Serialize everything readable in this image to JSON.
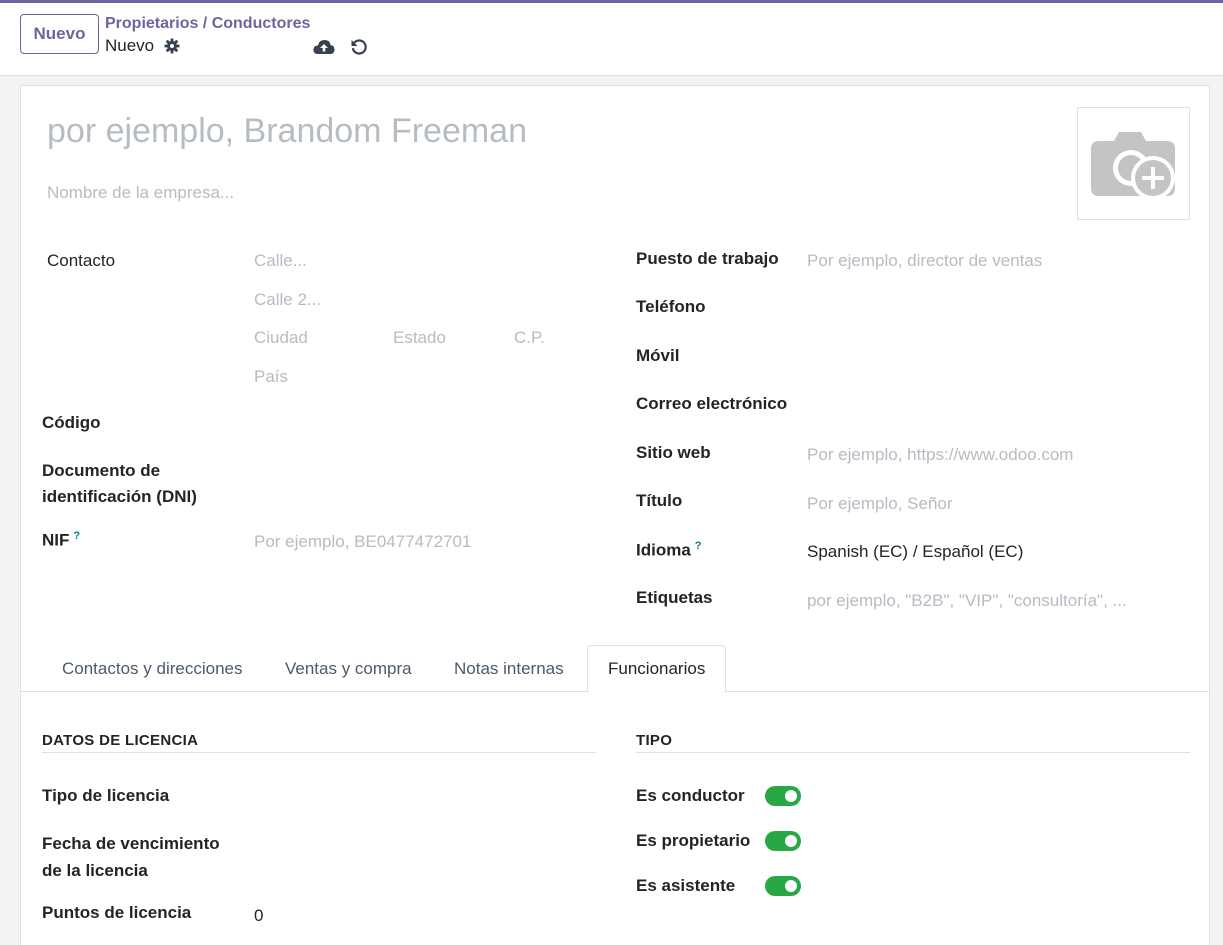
{
  "header": {
    "new_button": "Nuevo",
    "breadcrumb_parent": "Propietarios / Conductores",
    "breadcrumb_current": "Nuevo",
    "icons": [
      "gear-icon",
      "cloud-upload-icon",
      "undo-icon"
    ]
  },
  "form": {
    "name_placeholder": "por ejemplo, Brandom Freeman",
    "company_placeholder": "Nombre de la empresa...",
    "avatar_icon": "camera-plus-icon",
    "left": {
      "contact_label": "Contacto",
      "street_ph": "Calle...",
      "street2_ph": "Calle 2...",
      "city_ph": "Ciudad",
      "state_ph": "Estado",
      "zip_ph": "C.P.",
      "country_ph": "País",
      "code_label": "Código",
      "dni_label_1": "Documento de",
      "dni_label_2": "identificación (DNI)",
      "nif_label": "NIF",
      "nif_help": "?",
      "nif_ph": "Por ejemplo, BE0477472701"
    },
    "right": {
      "job_label": "Puesto de trabajo",
      "job_ph": "Por ejemplo, director de ventas",
      "phone_label": "Teléfono",
      "mobile_label": "Móvil",
      "email_label": "Correo electrónico",
      "website_label": "Sitio web",
      "website_ph": "Por ejemplo, https://www.odoo.com",
      "title_label": "Título",
      "title_ph": "Por ejemplo, Señor",
      "lang_label": "Idioma",
      "lang_help": "?",
      "lang_value": "Spanish (EC) / Español (EC)",
      "tags_label": "Etiquetas",
      "tags_ph": "por ejemplo, \"B2B\", \"VIP\", \"consultoría\", ..."
    }
  },
  "tabs": [
    {
      "label": "Contactos y direcciones",
      "active": false
    },
    {
      "label": "Ventas y compra",
      "active": false
    },
    {
      "label": "Notas internas",
      "active": false
    },
    {
      "label": "Funcionarios",
      "active": true
    }
  ],
  "license": {
    "section_title": "DATOS DE LICENCIA",
    "type_label": "Tipo de licencia",
    "expiry_label_1": "Fecha de vencimiento",
    "expiry_label_2": "de la licencia",
    "points_label": "Puntos de licencia",
    "points_value": "0"
  },
  "tipo": {
    "section_title": "TIPO",
    "driver_label": "Es conductor",
    "owner_label": "Es propietario",
    "assistant_label": "Es asistente",
    "accent_color": "#28a745"
  }
}
